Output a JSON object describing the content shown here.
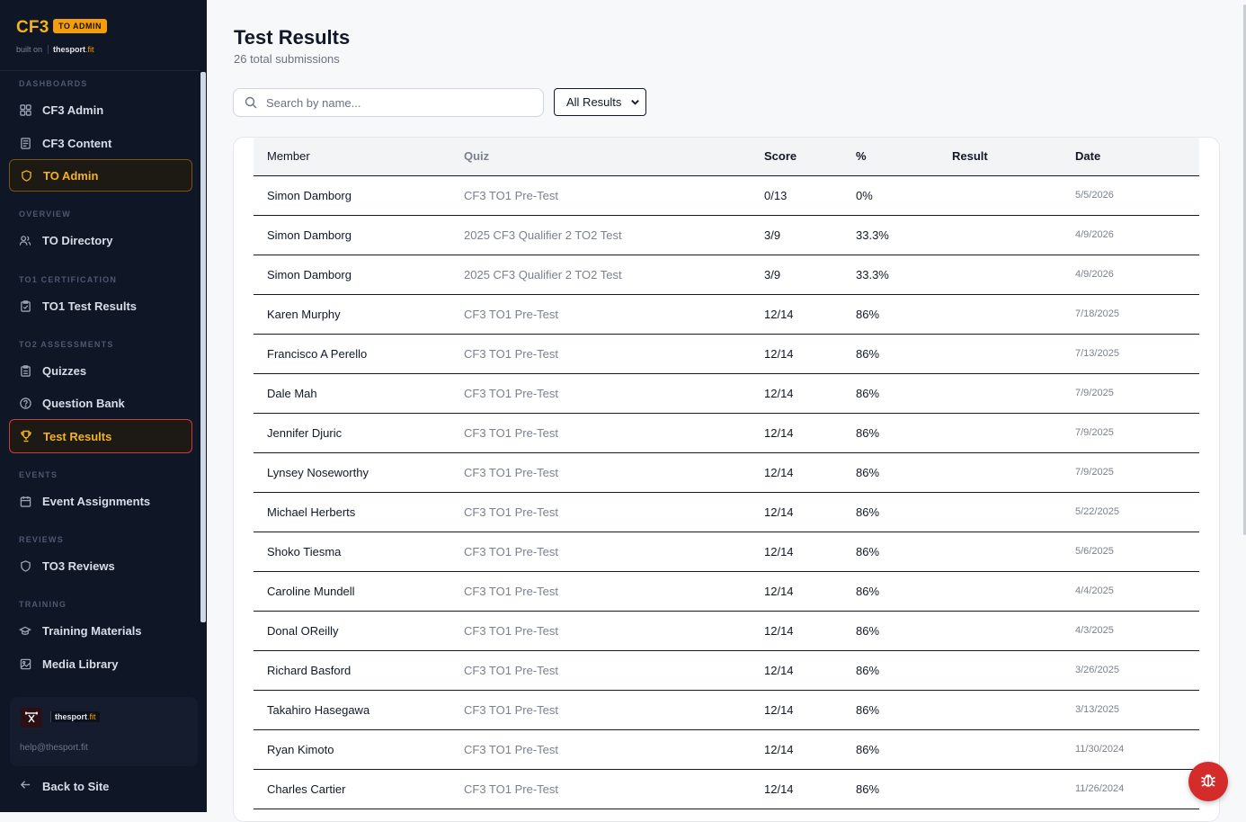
{
  "brand": {
    "title": "CF3",
    "badge": "TO ADMIN",
    "built_on": "built on",
    "partner_name": "thesport",
    "partner_suffix": ".fit"
  },
  "nav": {
    "sections": {
      "dashboards": "DASHBOARDS",
      "overview": "OVERVIEW",
      "to1": "TO1 CERTIFICATION",
      "to2": "TO2 ASSESSMENTS",
      "events": "EVENTS",
      "reviews": "REVIEWS",
      "training": "TRAINING"
    },
    "items": {
      "cf3_admin": "CF3 Admin",
      "cf3_content": "CF3 Content",
      "to_admin": "TO Admin",
      "to_directory": "TO Directory",
      "to1_test_results": "TO1 Test Results",
      "quizzes": "Quizzes",
      "question_bank": "Question Bank",
      "test_results": "Test Results",
      "event_assignments": "Event Assignments",
      "to3_reviews": "TO3 Reviews",
      "training_materials": "Training Materials",
      "media_library": "Media Library"
    },
    "back_to_site": "Back to Site"
  },
  "footer": {
    "partner_name": "thesport",
    "partner_suffix": ".fit",
    "email": "help@thesport.fit"
  },
  "page": {
    "title": "Test Results",
    "subtitle": "26 total submissions"
  },
  "search": {
    "placeholder": "Search by name..."
  },
  "filter": {
    "selected": "All Results"
  },
  "table": {
    "headers": {
      "member": "Member",
      "quiz": "Quiz",
      "score": "Score",
      "percent": "%",
      "result": "Result",
      "date": "Date"
    },
    "rows": [
      {
        "member": "Simon Damborg",
        "quiz": "CF3 TO1 Pre-Test",
        "score": "0/13",
        "percent": "0%",
        "result": "",
        "date": "5/5/2026"
      },
      {
        "member": "Simon Damborg",
        "quiz": "2025 CF3 Qualifier 2 TO2 Test",
        "score": "3/9",
        "percent": "33.3%",
        "result": "",
        "date": "4/9/2026"
      },
      {
        "member": "Simon Damborg",
        "quiz": "2025 CF3 Qualifier 2 TO2 Test",
        "score": "3/9",
        "percent": "33.3%",
        "result": "",
        "date": "4/9/2026"
      },
      {
        "member": "Karen Murphy",
        "quiz": "CF3 TO1 Pre-Test",
        "score": "12/14",
        "percent": "86%",
        "result": "",
        "date": "7/18/2025"
      },
      {
        "member": "Francisco A Perello",
        "quiz": "CF3 TO1 Pre-Test",
        "score": "12/14",
        "percent": "86%",
        "result": "",
        "date": "7/13/2025"
      },
      {
        "member": "Dale Mah",
        "quiz": "CF3 TO1 Pre-Test",
        "score": "12/14",
        "percent": "86%",
        "result": "",
        "date": "7/9/2025"
      },
      {
        "member": "Jennifer Djuric",
        "quiz": "CF3 TO1 Pre-Test",
        "score": "12/14",
        "percent": "86%",
        "result": "",
        "date": "7/9/2025"
      },
      {
        "member": "Lynsey Noseworthy",
        "quiz": "CF3 TO1 Pre-Test",
        "score": "12/14",
        "percent": "86%",
        "result": "",
        "date": "7/9/2025"
      },
      {
        "member": "Michael Herberts",
        "quiz": "CF3 TO1 Pre-Test",
        "score": "12/14",
        "percent": "86%",
        "result": "",
        "date": "5/22/2025"
      },
      {
        "member": "Shoko Tiesma",
        "quiz": "CF3 TO1 Pre-Test",
        "score": "12/14",
        "percent": "86%",
        "result": "",
        "date": "5/6/2025"
      },
      {
        "member": "Caroline Mundell",
        "quiz": "CF3 TO1 Pre-Test",
        "score": "12/14",
        "percent": "86%",
        "result": "",
        "date": "4/4/2025"
      },
      {
        "member": "Donal OReilly",
        "quiz": "CF3 TO1 Pre-Test",
        "score": "12/14",
        "percent": "86%",
        "result": "",
        "date": "4/3/2025"
      },
      {
        "member": "Richard Basford",
        "quiz": "CF3 TO1 Pre-Test",
        "score": "12/14",
        "percent": "86%",
        "result": "",
        "date": "3/26/2025"
      },
      {
        "member": "Takahiro Hasegawa",
        "quiz": "CF3 TO1 Pre-Test",
        "score": "12/14",
        "percent": "86%",
        "result": "",
        "date": "3/13/2025"
      },
      {
        "member": "Ryan Kimoto",
        "quiz": "CF3 TO1 Pre-Test",
        "score": "12/14",
        "percent": "86%",
        "result": "",
        "date": "11/30/2024"
      },
      {
        "member": "Charles Cartier",
        "quiz": "CF3 TO1 Pre-Test",
        "score": "12/14",
        "percent": "86%",
        "result": "",
        "date": "11/26/2024"
      }
    ]
  },
  "colors": {
    "sidebar_bg": "#0f1626",
    "accent": "#f5b21c",
    "active_border_red": "#d4393a",
    "fab": "#d42b2b"
  },
  "icons": {
    "fab": "bug-icon"
  }
}
